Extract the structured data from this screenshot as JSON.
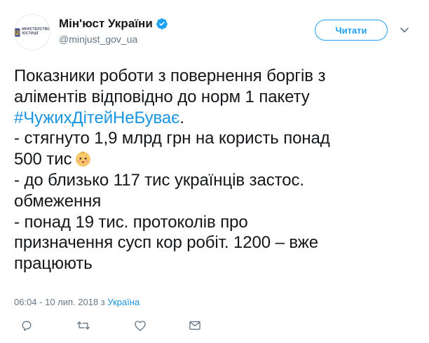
{
  "account": {
    "display_name": "Мін'юст України",
    "handle": "@minjust_gov_ua",
    "avatar_text": [
      "МІНІСТЕРСТВО",
      "ЮСТИЦІЇ"
    ]
  },
  "header": {
    "follow_label": "Читати"
  },
  "tweet": {
    "lines": [
      "Показники роботи з повернення боргів з",
      "аліментів відповідно до норм 1 пакету",
      "- стягнуто 1,9 млрд грн на користь понад",
      "500 тис",
      "- до близько 117 тис українців застос.",
      "обмеження",
      "- понад 19 тис. протоколів про",
      "призначення сусп кор робіт. 1200 – вже",
      "працюють"
    ],
    "hashtag": "#ЧужихДітейНеБуває",
    "hashtag_suffix": "."
  },
  "meta": {
    "timestamp": "06:04 - 10 лип. 2018 з",
    "place": "Україна"
  },
  "icons": {
    "reply": "reply-icon",
    "retweet": "retweet-icon",
    "like": "heart-icon",
    "message": "direct-message-icon",
    "more": "chevron-down-icon",
    "verified": "verified-badge-icon",
    "emoji": "baby-emoji"
  },
  "colors": {
    "accent": "#1da1f2",
    "hashtag": "#1b95e0",
    "muted": "#657786",
    "text": "#14171a"
  }
}
